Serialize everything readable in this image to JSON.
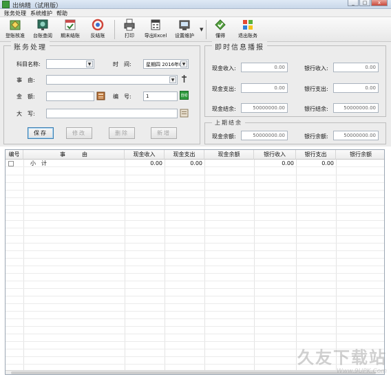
{
  "window": {
    "title": "出纳精（试用版）",
    "minimize": "_",
    "maximize": "□",
    "close": "x"
  },
  "menu": [
    "账务处理",
    "系统维护",
    "帮助"
  ],
  "toolbar": [
    {
      "label": "登账核准",
      "icon": "ledger-approve-icon"
    },
    {
      "label": "台账查阅",
      "icon": "ledger-view-icon"
    },
    {
      "label": "期末结账",
      "icon": "period-close-icon"
    },
    {
      "label": "反结账",
      "icon": "reverse-close-icon"
    },
    {
      "label": "打印",
      "icon": "printer-icon"
    },
    {
      "label": "导出Excel",
      "icon": "excel-export-icon"
    },
    {
      "label": "设置维护",
      "icon": "settings-icon"
    },
    {
      "label": "懂得",
      "icon": "help-icon"
    },
    {
      "label": "退出账务",
      "icon": "exit-icon"
    }
  ],
  "entry": {
    "title": "账务处理",
    "account_label": "科目名称:",
    "account_value": "",
    "time_label": "时　间:",
    "time_value": "星期四 2016年06",
    "desc_label": "事　由:",
    "desc_value": "",
    "amount_label": "金　额:",
    "amount_value": "",
    "number_label": "编　号:",
    "number_value": "1",
    "capital_label": "大　写:",
    "capital_value": "",
    "auto_badge": "自动",
    "buttons": {
      "save": "保存",
      "modify": "修改",
      "delete": "删除",
      "add": "新增"
    }
  },
  "realtime": {
    "title": "即时信息播报",
    "cash_in_label": "现金收入:",
    "cash_in": "0.00",
    "bank_in_label": "银行收入:",
    "bank_in": "0.00",
    "cash_out_label": "现金支出:",
    "cash_out": "0.00",
    "bank_out_label": "银行支出:",
    "bank_out": "0.00",
    "cash_bal_label": "现金结余:",
    "cash_bal": "50000000.00",
    "bank_bal_label": "银行结余:",
    "bank_bal": "50000000.00"
  },
  "last_period": {
    "title": "上期结余",
    "cash_label": "现金余额:",
    "cash": "50000000.00",
    "bank_label": "银行余额:",
    "bank": "50000000.00"
  },
  "table": {
    "headers": [
      "编号",
      "事　　　由",
      "现金收入",
      "现金支出",
      "现金余额",
      "银行收入",
      "银行支出",
      "银行余额"
    ],
    "subtotal": {
      "label": "小　计",
      "cash_in": "0.00",
      "cash_out": "0.00",
      "bank_in": "0.00",
      "bank_out": "0.00"
    }
  },
  "watermark": {
    "big": "久友下载站",
    "small": "Www.9UPK.Com"
  }
}
